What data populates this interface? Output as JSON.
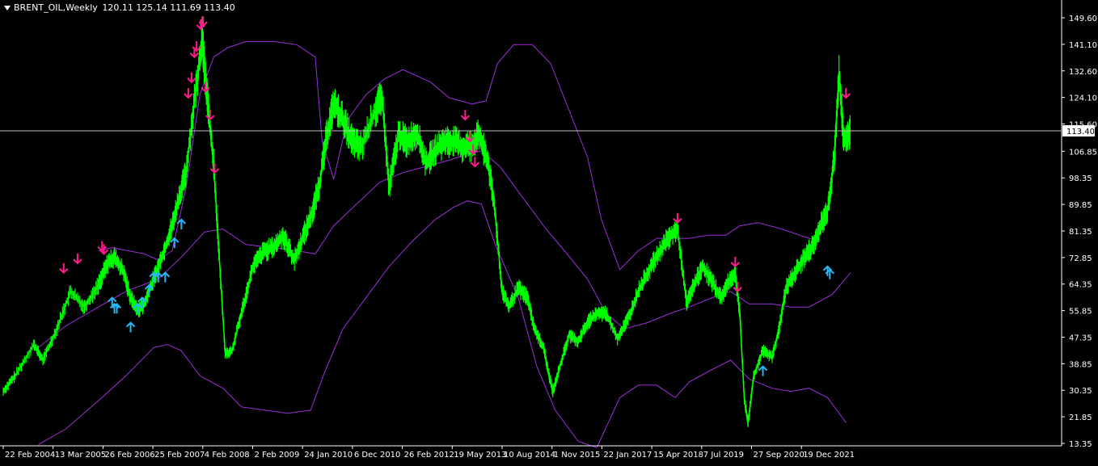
{
  "header": {
    "symbol": "BRENT_OIL,Weekly",
    "ohlc": "120.11 125.14 111.69 113.40"
  },
  "colors": {
    "background": "#000000",
    "price": "#00ff00",
    "bands": "#9b30d9",
    "sell_arrow": "#ff1a8c",
    "buy_arrow": "#29b6f6",
    "axis": "#ffffff",
    "current_line": "#c0c0c0"
  },
  "chart_data": {
    "type": "line",
    "current_price": "113.40",
    "y_ticks": [
      "149.60",
      "141.10",
      "132.60",
      "124.10",
      "115.60",
      "106.85",
      "98.35",
      "89.85",
      "81.35",
      "72.85",
      "64.35",
      "55.85",
      "47.35",
      "38.85",
      "30.35",
      "21.85",
      "13.35"
    ],
    "x_ticks": [
      "22 Feb 2004",
      "13 Mar 2005",
      "26 Feb 2006",
      "25 Feb 2007",
      "4 Feb 2008",
      "2 Feb 2009",
      "24 Jan 2010",
      "6 Dec 2010",
      "26 Feb 2012",
      "19 May 2013",
      "10 Aug 2014",
      "1 Nov 2015",
      "22 Jan 2017",
      "15 Apr 2018",
      "7 Jul 2019",
      "27 Sep 2020",
      "19 Dec 2021"
    ],
    "ylim": [
      13.35,
      153
    ],
    "price_series": [
      [
        2004.14,
        30
      ],
      [
        2004.4,
        35
      ],
      [
        2004.8,
        45
      ],
      [
        2005.0,
        40
      ],
      [
        2005.3,
        50
      ],
      [
        2005.6,
        62
      ],
      [
        2005.9,
        57
      ],
      [
        2006.2,
        64
      ],
      [
        2006.4,
        71
      ],
      [
        2006.55,
        73
      ],
      [
        2006.75,
        68
      ],
      [
        2006.9,
        60
      ],
      [
        2007.05,
        56
      ],
      [
        2007.2,
        58
      ],
      [
        2007.4,
        66
      ],
      [
        2007.6,
        74
      ],
      [
        2007.8,
        83
      ],
      [
        2007.95,
        92
      ],
      [
        2008.1,
        100
      ],
      [
        2008.3,
        125
      ],
      [
        2008.45,
        143
      ],
      [
        2008.5,
        134
      ],
      [
        2008.6,
        118
      ],
      [
        2008.7,
        103
      ],
      [
        2008.8,
        78
      ],
      [
        2008.95,
        42
      ],
      [
        2009.1,
        43
      ],
      [
        2009.3,
        55
      ],
      [
        2009.55,
        70
      ],
      [
        2009.8,
        75
      ],
      [
        2010.0,
        76
      ],
      [
        2010.2,
        80
      ],
      [
        2010.45,
        72
      ],
      [
        2010.65,
        80
      ],
      [
        2010.85,
        88
      ],
      [
        2011.0,
        97
      ],
      [
        2011.15,
        112
      ],
      [
        2011.3,
        122
      ],
      [
        2011.5,
        117
      ],
      [
        2011.7,
        110
      ],
      [
        2011.9,
        108
      ],
      [
        2012.2,
        120
      ],
      [
        2012.35,
        124
      ],
      [
        2012.5,
        95
      ],
      [
        2012.7,
        112
      ],
      [
        2012.9,
        110
      ],
      [
        2013.1,
        113
      ],
      [
        2013.3,
        103
      ],
      [
        2013.5,
        107
      ],
      [
        2013.7,
        110
      ],
      [
        2013.9,
        110
      ],
      [
        2014.1,
        108
      ],
      [
        2014.3,
        109
      ],
      [
        2014.45,
        112
      ],
      [
        2014.65,
        103
      ],
      [
        2014.8,
        87
      ],
      [
        2014.95,
        62
      ],
      [
        2015.1,
        57
      ],
      [
        2015.3,
        63
      ],
      [
        2015.5,
        60
      ],
      [
        2015.65,
        50
      ],
      [
        2015.85,
        44
      ],
      [
        2015.95,
        36
      ],
      [
        2016.05,
        30
      ],
      [
        2016.2,
        38
      ],
      [
        2016.4,
        48
      ],
      [
        2016.6,
        46
      ],
      [
        2016.8,
        52
      ],
      [
        2017.0,
        55
      ],
      [
        2017.2,
        55
      ],
      [
        2017.45,
        47
      ],
      [
        2017.7,
        54
      ],
      [
        2017.9,
        62
      ],
      [
        2018.1,
        68
      ],
      [
        2018.3,
        73
      ],
      [
        2018.5,
        78
      ],
      [
        2018.75,
        82
      ],
      [
        2018.95,
        58
      ],
      [
        2019.1,
        64
      ],
      [
        2019.3,
        70
      ],
      [
        2019.5,
        65
      ],
      [
        2019.7,
        60
      ],
      [
        2019.85,
        65
      ],
      [
        2020.0,
        68
      ],
      [
        2020.1,
        55
      ],
      [
        2020.2,
        27
      ],
      [
        2020.28,
        20
      ],
      [
        2020.4,
        35
      ],
      [
        2020.6,
        43
      ],
      [
        2020.8,
        41
      ],
      [
        2020.95,
        50
      ],
      [
        2021.1,
        63
      ],
      [
        2021.3,
        68
      ],
      [
        2021.5,
        73
      ],
      [
        2021.7,
        77
      ],
      [
        2021.85,
        83
      ],
      [
        2022.0,
        88
      ],
      [
        2022.15,
        105
      ],
      [
        2022.25,
        132
      ],
      [
        2022.35,
        110
      ],
      [
        2022.5,
        113.4
      ]
    ],
    "upper_band": [
      [
        2006.2,
        75
      ],
      [
        2006.5,
        76
      ],
      [
        2007.2,
        74
      ],
      [
        2007.5,
        72
      ],
      [
        2007.8,
        75
      ],
      [
        2008.1,
        95
      ],
      [
        2008.4,
        125
      ],
      [
        2008.7,
        137
      ],
      [
        2009.0,
        140
      ],
      [
        2009.4,
        142
      ],
      [
        2010.0,
        142
      ],
      [
        2010.5,
        141
      ],
      [
        2010.9,
        137
      ],
      [
        2011.05,
        110
      ],
      [
        2011.3,
        98
      ],
      [
        2011.6,
        117
      ],
      [
        2012.0,
        125
      ],
      [
        2012.4,
        130
      ],
      [
        2012.8,
        133
      ],
      [
        2013.4,
        129
      ],
      [
        2013.8,
        124
      ],
      [
        2014.3,
        122
      ],
      [
        2014.6,
        123
      ],
      [
        2014.85,
        135
      ],
      [
        2015.2,
        141
      ],
      [
        2015.6,
        141
      ],
      [
        2016.0,
        135
      ],
      [
        2016.4,
        120
      ],
      [
        2016.8,
        105
      ],
      [
        2017.1,
        85
      ],
      [
        2017.5,
        69
      ],
      [
        2017.9,
        75
      ],
      [
        2018.3,
        79
      ],
      [
        2018.7,
        79
      ],
      [
        2019.0,
        79
      ],
      [
        2019.4,
        80
      ],
      [
        2019.8,
        80
      ],
      [
        2020.1,
        83
      ],
      [
        2020.5,
        84
      ],
      [
        2021.0,
        82
      ],
      [
        2021.4,
        80
      ],
      [
        2021.8,
        78
      ]
    ],
    "middle_band": [
      [
        2004.9,
        44
      ],
      [
        2005.5,
        51
      ],
      [
        2006.2,
        57
      ],
      [
        2006.8,
        62
      ],
      [
        2007.5,
        66
      ],
      [
        2008.0,
        73
      ],
      [
        2008.5,
        81
      ],
      [
        2008.9,
        82
      ],
      [
        2009.4,
        77
      ],
      [
        2010.0,
        76
      ],
      [
        2010.5,
        75
      ],
      [
        2010.9,
        74
      ],
      [
        2011.3,
        83
      ],
      [
        2011.8,
        90
      ],
      [
        2012.3,
        97
      ],
      [
        2012.8,
        100
      ],
      [
        2013.3,
        102
      ],
      [
        2013.8,
        104
      ],
      [
        2014.2,
        106
      ],
      [
        2014.5,
        107
      ],
      [
        2014.9,
        102
      ],
      [
        2015.4,
        92
      ],
      [
        2015.9,
        82
      ],
      [
        2016.3,
        75
      ],
      [
        2016.8,
        66
      ],
      [
        2017.2,
        55
      ],
      [
        2017.6,
        50
      ],
      [
        2018.1,
        52
      ],
      [
        2018.6,
        55
      ],
      [
        2019.0,
        57
      ],
      [
        2019.5,
        60
      ],
      [
        2019.9,
        62
      ],
      [
        2020.3,
        58
      ],
      [
        2020.8,
        58
      ],
      [
        2021.2,
        57
      ],
      [
        2021.6,
        57
      ],
      [
        2022.1,
        61
      ],
      [
        2022.5,
        68
      ]
    ],
    "lower_band": [
      [
        2004.9,
        13
      ],
      [
        2005.5,
        18
      ],
      [
        2006.2,
        27
      ],
      [
        2006.8,
        35
      ],
      [
        2007.4,
        44
      ],
      [
        2007.7,
        45
      ],
      [
        2008.0,
        43
      ],
      [
        2008.4,
        35
      ],
      [
        2008.9,
        31
      ],
      [
        2009.3,
        25
      ],
      [
        2009.8,
        24
      ],
      [
        2010.3,
        23
      ],
      [
        2010.8,
        24
      ],
      [
        2011.1,
        36
      ],
      [
        2011.5,
        50
      ],
      [
        2012.0,
        60
      ],
      [
        2012.5,
        70
      ],
      [
        2013.0,
        78
      ],
      [
        2013.5,
        85
      ],
      [
        2013.9,
        89
      ],
      [
        2014.2,
        91
      ],
      [
        2014.5,
        90
      ],
      [
        2014.8,
        77
      ],
      [
        2015.3,
        60
      ],
      [
        2015.7,
        38
      ],
      [
        2016.1,
        24
      ],
      [
        2016.6,
        14
      ],
      [
        2017.0,
        12
      ],
      [
        2017.5,
        28
      ],
      [
        2017.9,
        32
      ],
      [
        2018.3,
        32
      ],
      [
        2018.7,
        28
      ],
      [
        2019.0,
        33
      ],
      [
        2019.5,
        37
      ],
      [
        2019.9,
        40
      ],
      [
        2020.3,
        34
      ],
      [
        2020.8,
        31
      ],
      [
        2021.2,
        30
      ],
      [
        2021.6,
        31
      ],
      [
        2022.0,
        28
      ],
      [
        2022.4,
        20
      ]
    ],
    "sell_arrows": [
      [
        2005.45,
        68
      ],
      [
        2005.75,
        71
      ],
      [
        2006.28,
        75
      ],
      [
        2006.32,
        74
      ],
      [
        2008.15,
        124
      ],
      [
        2008.22,
        129
      ],
      [
        2008.28,
        137
      ],
      [
        2008.33,
        139
      ],
      [
        2008.42,
        146
      ],
      [
        2008.47,
        147
      ],
      [
        2008.52,
        126
      ],
      [
        2008.62,
        117
      ],
      [
        2008.72,
        100
      ],
      [
        2014.15,
        117
      ],
      [
        2014.25,
        110
      ],
      [
        2014.32,
        106
      ],
      [
        2014.36,
        102
      ],
      [
        2018.75,
        84
      ],
      [
        2020.0,
        70
      ],
      [
        2020.05,
        62
      ],
      [
        2022.4,
        124
      ]
    ],
    "buy_arrows": [
      [
        2006.5,
        60
      ],
      [
        2006.55,
        58
      ],
      [
        2006.6,
        58
      ],
      [
        2006.9,
        52
      ],
      [
        2007.05,
        58
      ],
      [
        2007.15,
        60
      ],
      [
        2007.3,
        64
      ],
      [
        2007.4,
        68
      ],
      [
        2007.5,
        68
      ],
      [
        2007.65,
        68
      ],
      [
        2007.85,
        79
      ],
      [
        2008.0,
        85
      ],
      [
        2020.6,
        38
      ],
      [
        2022.0,
        70
      ],
      [
        2022.05,
        69
      ]
    ]
  }
}
